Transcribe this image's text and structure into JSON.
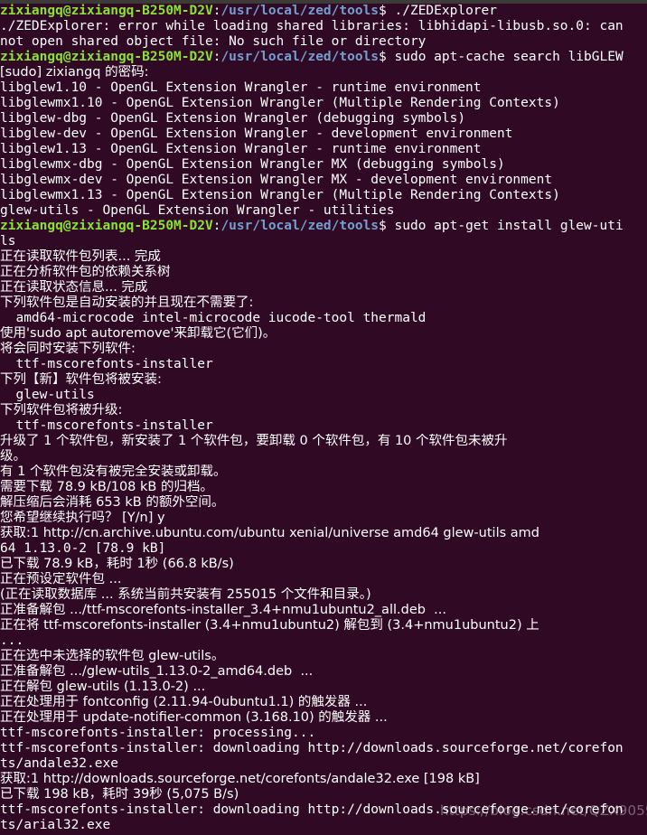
{
  "window": {
    "title": "zixiangq@zixiangq-B250M-D2V: /usr/local/zed/tools",
    "background_color": "#300a24",
    "foreground_color": "#ffffff",
    "prompt_user_color": "#8ae234",
    "prompt_path_color": "#729fcf",
    "titlebar_color": "#3c3b37"
  },
  "prompt": {
    "user_host": "zixiangq@zixiangq-B250M-D2V",
    "separator": ":",
    "path": "/usr/local/zed/tools",
    "symbol": "$"
  },
  "watermark": {
    "text": "https://blog.csdn.net/QZX9059"
  },
  "lines": [
    {
      "type": "prompt",
      "command": " ./ZEDExplorer"
    },
    {
      "type": "out",
      "text": "./ZEDExplorer: error while loading shared libraries: libhidapi-libusb.so.0: can"
    },
    {
      "type": "out",
      "text": "not open shared object file: No such file or directory"
    },
    {
      "type": "prompt",
      "command": " sudo apt-cache search libGLEW"
    },
    {
      "type": "out",
      "text": "[sudo] zixiangq ",
      "cjk": true,
      "text2": "的密码:"
    },
    {
      "type": "out",
      "text": "libglew1.10 - OpenGL Extension Wrangler - runtime environment"
    },
    {
      "type": "out",
      "text": "libglewmx1.10 - OpenGL Extension Wrangler (Multiple Rendering Contexts)"
    },
    {
      "type": "out",
      "text": "libglew-dbg - OpenGL Extension Wrangler (debugging symbols)"
    },
    {
      "type": "out",
      "text": "libglew-dev - OpenGL Extension Wrangler - development environment"
    },
    {
      "type": "out",
      "text": "libglew1.13 - OpenGL Extension Wrangler - runtime environment"
    },
    {
      "type": "out",
      "text": "libglewmx-dbg - OpenGL Extension Wrangler MX (debugging symbols)"
    },
    {
      "type": "out",
      "text": "libglewmx-dev - OpenGL Extension Wrangler MX - development environment"
    },
    {
      "type": "out",
      "text": "libglewmx1.13 - OpenGL Extension Wrangler (Multiple Rendering Contexts)"
    },
    {
      "type": "out",
      "text": "glew-utils - OpenGL Extension Wrangler - utilities"
    },
    {
      "type": "prompt",
      "command": " sudo apt-get install glew-uti"
    },
    {
      "type": "out",
      "text": "ls"
    },
    {
      "type": "cjk",
      "text": "正在读取软件包列表... 完成"
    },
    {
      "type": "cjk",
      "text": "正在分析软件包的依赖关系树"
    },
    {
      "type": "cjk",
      "text": "正在读取状态信息... 完成"
    },
    {
      "type": "cjk",
      "text": "下列软件包是自动安装的并且现在不需要了:"
    },
    {
      "type": "out",
      "text": "  amd64-microcode intel-microcode iucode-tool thermald"
    },
    {
      "type": "cjk",
      "text": "使用'sudo apt autoremove'来卸载它(它们)。"
    },
    {
      "type": "cjk",
      "text": "将会同时安装下列软件:"
    },
    {
      "type": "out",
      "text": "  ttf-mscorefonts-installer"
    },
    {
      "type": "cjk",
      "text": "下列【新】软件包将被安装:"
    },
    {
      "type": "out",
      "text": "  glew-utils"
    },
    {
      "type": "cjk",
      "text": "下列软件包将被升级:"
    },
    {
      "type": "out",
      "text": "  ttf-mscorefonts-installer"
    },
    {
      "type": "cjk",
      "text": "升级了 1 个软件包，新安装了 1 个软件包，要卸载 0 个软件包，有 10 个软件包未被升"
    },
    {
      "type": "cjk",
      "text": "级。"
    },
    {
      "type": "cjk",
      "text": "有 1 个软件包没有被完全安装或卸载。"
    },
    {
      "type": "cjk",
      "text": "需要下载 78.9 kB/108 kB 的归档。"
    },
    {
      "type": "cjk",
      "text": "解压缩后会消耗 653 kB 的额外空间。"
    },
    {
      "type": "cjk",
      "text": "您希望继续执行吗？ [Y/n] y"
    },
    {
      "type": "cjk",
      "text": "获取:1 http://cn.archive.ubuntu.com/ubuntu xenial/universe amd64 glew-utils amd"
    },
    {
      "type": "out",
      "text": "64 1.13.0-2 [78.9 kB]"
    },
    {
      "type": "cjk",
      "text": "已下载 78.9 kB，耗时 1秒 (66.8 kB/s)"
    },
    {
      "type": "cjk",
      "text": "正在预设定软件包 ..."
    },
    {
      "type": "cjk",
      "text": "(正在读取数据库 ... 系统当前共安装有 255015 个文件和目录。)"
    },
    {
      "type": "cjk",
      "text": "正准备解包 .../ttf-mscorefonts-installer_3.4+nmu1ubuntu2_all.deb  ..."
    },
    {
      "type": "cjk",
      "text": "正在将 ttf-mscorefonts-installer (3.4+nmu1ubuntu2) 解包到 (3.4+nmu1ubuntu2) 上"
    },
    {
      "type": "out",
      "text": "..."
    },
    {
      "type": "cjk",
      "text": "正在选中未选择的软件包 glew-utils。"
    },
    {
      "type": "cjk",
      "text": "正准备解包 .../glew-utils_1.13.0-2_amd64.deb  ..."
    },
    {
      "type": "cjk",
      "text": "正在解包 glew-utils (1.13.0-2) ..."
    },
    {
      "type": "cjk",
      "text": "正在处理用于 fontconfig (2.11.94-0ubuntu1.1) 的触发器 ..."
    },
    {
      "type": "cjk",
      "text": "正在处理用于 update-notifier-common (3.168.10) 的触发器 ..."
    },
    {
      "type": "out",
      "text": "ttf-mscorefonts-installer: processing..."
    },
    {
      "type": "out",
      "text": "ttf-mscorefonts-installer: downloading http://downloads.sourceforge.net/corefon"
    },
    {
      "type": "out",
      "text": "ts/andale32.exe"
    },
    {
      "type": "cjk",
      "text": "获取:1 http://downloads.sourceforge.net/corefonts/andale32.exe [198 kB]"
    },
    {
      "type": "cjk",
      "text": "已下载 198 kB，耗时 39秒 (5,075 B/s)"
    },
    {
      "type": "out",
      "text": "ttf-mscorefonts-installer: downloading http://downloads.sourceforge.net/corefon"
    },
    {
      "type": "out",
      "text": "ts/arial32.exe"
    }
  ]
}
